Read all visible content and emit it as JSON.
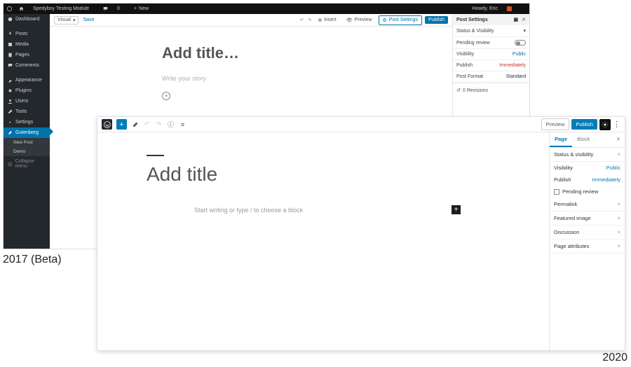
{
  "labels": {
    "y2017": "2017 (Beta)",
    "y2020": "2020"
  },
  "w17": {
    "adminbar": {
      "site": "Spedyboy Testing Module",
      "comments": "0",
      "new": "New",
      "howdy": "Howdy, Eric"
    },
    "side": {
      "items": [
        {
          "label": "Dashboard"
        },
        {
          "label": "Posts"
        },
        {
          "label": "Media"
        },
        {
          "label": "Pages"
        },
        {
          "label": "Comments"
        },
        {
          "label": "Appearance"
        },
        {
          "label": "Plugins"
        },
        {
          "label": "Users"
        },
        {
          "label": "Tools"
        },
        {
          "label": "Settings"
        },
        {
          "label": "Gutenberg"
        }
      ],
      "sub": [
        {
          "label": "New Post"
        },
        {
          "label": "Demo"
        }
      ],
      "collapse": "Collapse menu"
    },
    "toolbar": {
      "mode": "Visual",
      "save": "Save",
      "insert": "Insert",
      "preview": "Preview",
      "post_settings": "Post Settings",
      "publish": "Publish"
    },
    "canvas": {
      "title": "Add title…",
      "body": "Write your story"
    },
    "panel": {
      "header": "Post Settings",
      "status_label": "Status & Visibility",
      "pending_label": "Pending review",
      "visibility_label": "Visibility",
      "visibility_value": "Public",
      "publish_label": "Publish",
      "publish_value": "Immediately",
      "format_label": "Post Format",
      "format_value": "Standard",
      "revisions": "0 Revisions"
    }
  },
  "w20": {
    "top": {
      "preview": "Preview",
      "publish": "Publish"
    },
    "canvas": {
      "title": "Add title",
      "block": "Start writing or type / to choose a block"
    },
    "panel": {
      "tabs": {
        "page": "Page",
        "block": "Block"
      },
      "status": "Status & visibility",
      "visibility_label": "Visibility",
      "visibility_value": "Public",
      "publish_label": "Publish",
      "publish_value": "Immediately",
      "pending": "Pending review",
      "permalink": "Permalink",
      "featured": "Featured image",
      "discussion": "Discussion",
      "attrs": "Page attributes"
    }
  }
}
